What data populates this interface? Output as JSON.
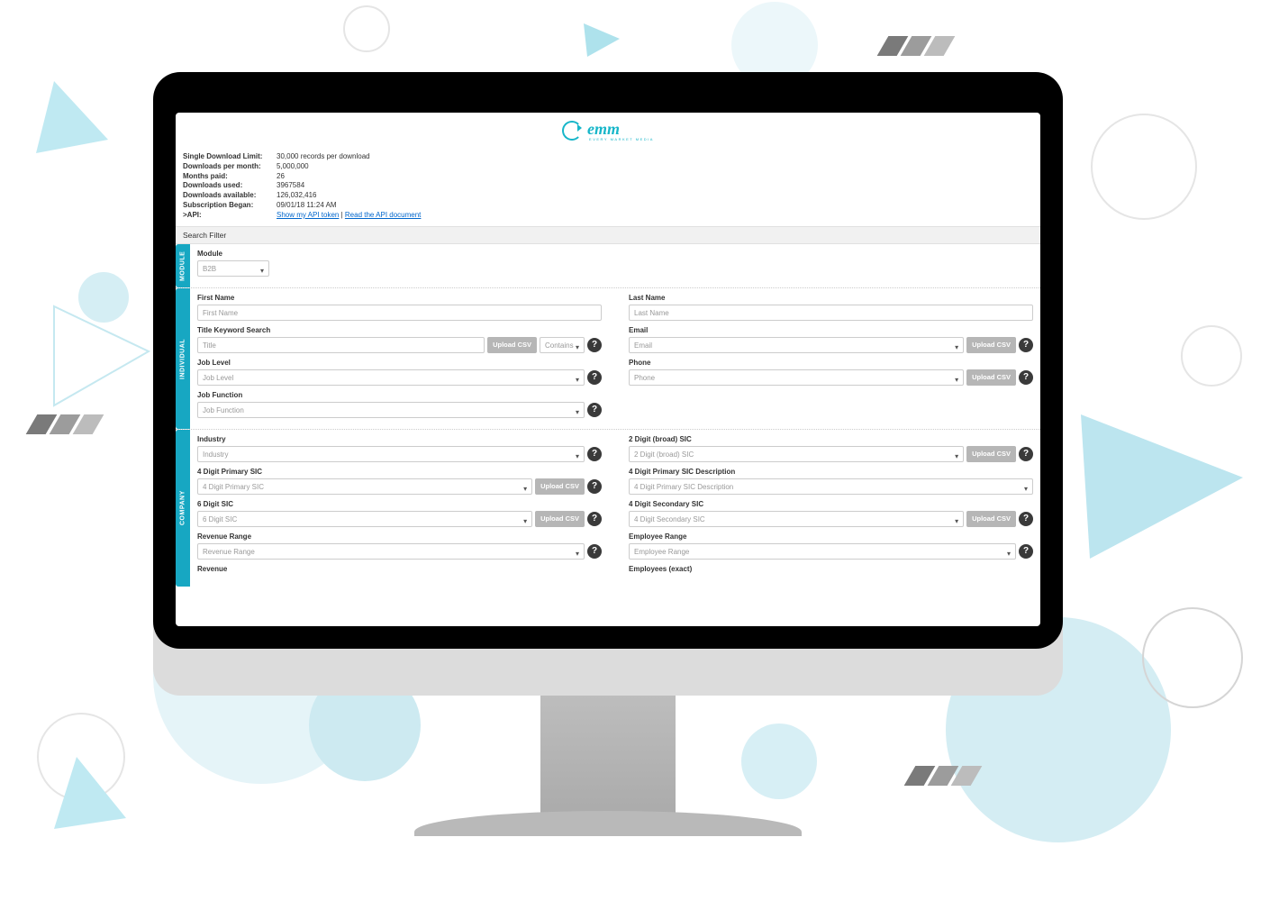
{
  "logo": {
    "text": "emm",
    "tagline": "EVERY MARKET MEDIA"
  },
  "info": {
    "limit_lbl": "Single Download Limit:",
    "limit_val": "30,000 records per download",
    "dpm_lbl": "Downloads per month:",
    "dpm_val": "5,000,000",
    "months_lbl": "Months paid:",
    "months_val": "26",
    "used_lbl": "Downloads used:",
    "used_val": "3967584",
    "avail_lbl": "Downloads available:",
    "avail_val": "126,032,416",
    "sub_lbl": "Subscription Began:",
    "sub_val": "09/01/18 11:24 AM",
    "api_lbl": ">API:",
    "api_link1": "Show my API token",
    "api_sep": " | ",
    "api_link2": "Read the API document"
  },
  "tabs": {
    "search_filter": "Search Filter"
  },
  "module": {
    "side": "MODULE",
    "label": "Module",
    "value": "B2B"
  },
  "individual": {
    "side": "INDIVIDUAL",
    "first_name_lbl": "First Name",
    "first_name_ph": "First Name",
    "last_name_lbl": "Last Name",
    "last_name_ph": "Last Name",
    "title_lbl": "Title Keyword Search",
    "title_ph": "Title",
    "title_contains": "Contains",
    "email_lbl": "Email",
    "email_ph": "Email",
    "job_level_lbl": "Job Level",
    "job_level_ph": "Job Level",
    "phone_lbl": "Phone",
    "phone_ph": "Phone",
    "job_fn_lbl": "Job Function",
    "job_fn_ph": "Job Function"
  },
  "company": {
    "side": "COMPANY",
    "industry_lbl": "Industry",
    "industry_ph": "Industry",
    "sic2_lbl": "2 Digit (broad) SIC",
    "sic2_ph": "2 Digit (broad) SIC",
    "sic4_lbl": "4 Digit Primary SIC",
    "sic4_ph": "4 Digit Primary SIC",
    "sic4desc_lbl": "4 Digit Primary SIC Description",
    "sic4desc_ph": "4 Digit Primary SIC Description",
    "sic6_lbl": "6 Digit SIC",
    "sic6_ph": "6 Digit SIC",
    "sic4sec_lbl": "4 Digit Secondary SIC",
    "sic4sec_ph": "4 Digit Secondary SIC",
    "rev_range_lbl": "Revenue Range",
    "rev_range_ph": "Revenue Range",
    "emp_range_lbl": "Employee Range",
    "emp_range_ph": "Employee Range",
    "rev_lbl": "Revenue",
    "emp_lbl": "Employees (exact)"
  },
  "buttons": {
    "upload_csv": "Upload CSV"
  }
}
